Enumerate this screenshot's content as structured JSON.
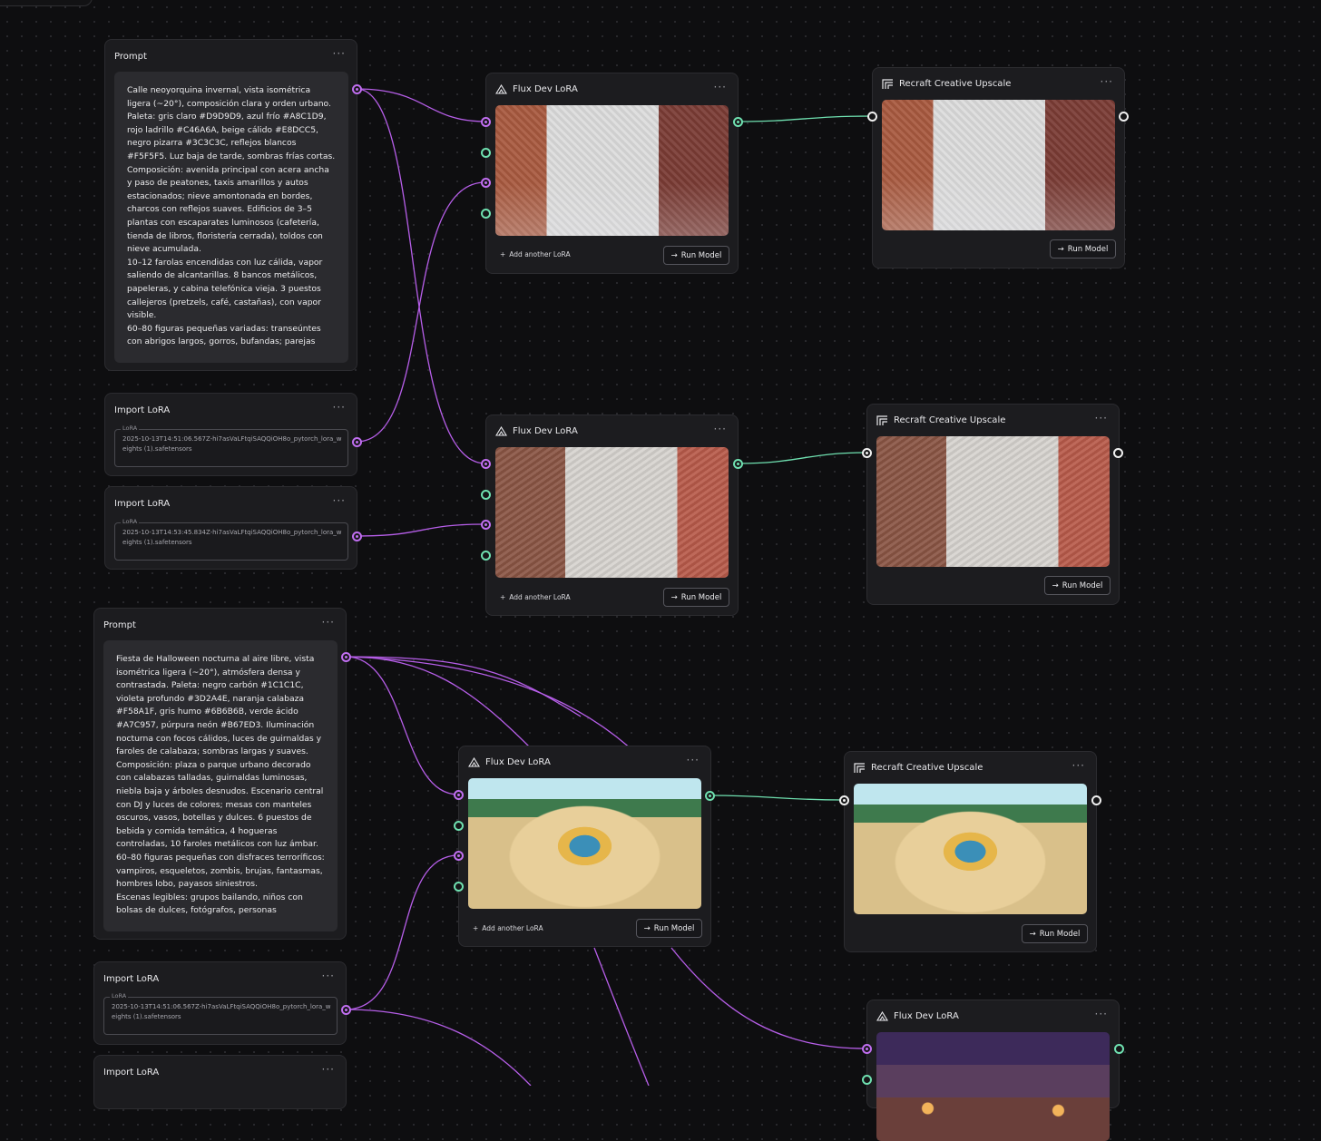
{
  "nodes": {
    "prompt1": {
      "title": "Prompt",
      "text": "Calle neoyorquina invernal, vista isométrica ligera (~20°), composición clara y orden urbano. Paleta: gris claro #D9D9D9, azul frío #A8C1D9, rojo ladrillo #C46A6A, beige cálido #E8DCC5, negro pizarra #3C3C3C, reflejos blancos #F5F5F5. Luz baja de tarde, sombras frías cortas.\nComposición: avenida principal con acera ancha y paso de peatones, taxis amarillos y autos estacionados; nieve amontonada en bordes, charcos con reflejos suaves. Edificios de 3–5 plantas con escaparates luminosos (cafetería, tienda de libros, floristería cerrada), toldos con nieve acumulada.\n10–12 farolas encendidas con luz cálida, vapor saliendo de alcantarillas. 8 bancos metálicos, papeleras, y cabina telefónica vieja. 3 puestos callejeros (pretzels, café, castañas), con vapor visible.\n60–80 figuras pequeñas variadas: transeúntes con abrigos largos, gorros, bufandas; parejas"
    },
    "lora1": {
      "title": "Import LoRA",
      "legend": "LoRA",
      "value": "2025-10-13T14:51:06.567Z-hi7asVaLFtqiSAQQiOH8o_pytorch_lora_weights (1).safetensors"
    },
    "lora2": {
      "title": "Import LoRA",
      "legend": "LoRA",
      "value": "2025-10-13T14:53:45.834Z-hi7asVaLFtqiSAQQiOH8o_pytorch_lora_weights (1).safetensors"
    },
    "prompt2": {
      "title": "Prompt",
      "text": "Fiesta de Halloween nocturna al aire libre, vista isométrica ligera (~20°), atmósfera densa y contrastada. Paleta: negro carbón #1C1C1C, violeta profundo #3D2A4E, naranja calabaza #F58A1F, gris humo #6B6B6B, verde ácido #A7C957, púrpura neón #B67ED3. Iluminación nocturna con focos cálidos, luces de guirnaldas y faroles de calabaza; sombras largas y suaves.\nComposición: plaza o parque urbano decorado con calabazas talladas, guirnaldas luminosas, niebla baja y árboles desnudos. Escenario central con DJ y luces de colores; mesas con manteles oscuros, vasos, botellas y dulces. 6 puestos de bebida y comida temática, 4 hogueras controladas, 10 faroles metálicos con luz ámbar.\n60–80 figuras pequeñas con disfraces terroríficos: vampiros, esqueletos, zombis, brujas, fantasmas, hombres lobo, payasos siniestros.\nEscenas legibles: grupos bailando, niños con bolsas de dulces, fotógrafos, personas"
    },
    "lora3": {
      "title": "Import LoRA",
      "legend": "LoRA",
      "value": "2025-10-13T14:51:06.567Z-hi7asVaLFtqiSAQQiOH8o_pytorch_lora_weights (1).safetensors"
    },
    "lora4": {
      "title": "Import LoRA"
    },
    "flux1": {
      "title": "Flux Dev LoRA",
      "add_lora": "Add another LoRA",
      "run": "Run Model"
    },
    "flux2": {
      "title": "Flux Dev LoRA",
      "add_lora": "Add another LoRA",
      "run": "Run Model"
    },
    "flux3": {
      "title": "Flux Dev LoRA",
      "add_lora": "Add another LoRA",
      "run": "Run Model"
    },
    "flux4": {
      "title": "Flux Dev LoRA"
    },
    "up1": {
      "title": "Recraft Creative Upscale",
      "run": "Run Model"
    },
    "up2": {
      "title": "Recraft Creative Upscale",
      "run": "Run Model"
    },
    "up3": {
      "title": "Recraft Creative Upscale",
      "run": "Run Model"
    }
  },
  "icons": {
    "menu": "more-dots-icon",
    "flux": "flux-logo-icon",
    "recraft": "recraft-logo-icon",
    "plus": "plus-icon",
    "arrow": "arrow-right-icon"
  },
  "colors": {
    "canvas": "#0e0e10",
    "node": "#1c1c1f",
    "text_wire": "#c06ef0",
    "image_wire": "#6fe0b0",
    "output_port": "#f0f0f0"
  }
}
